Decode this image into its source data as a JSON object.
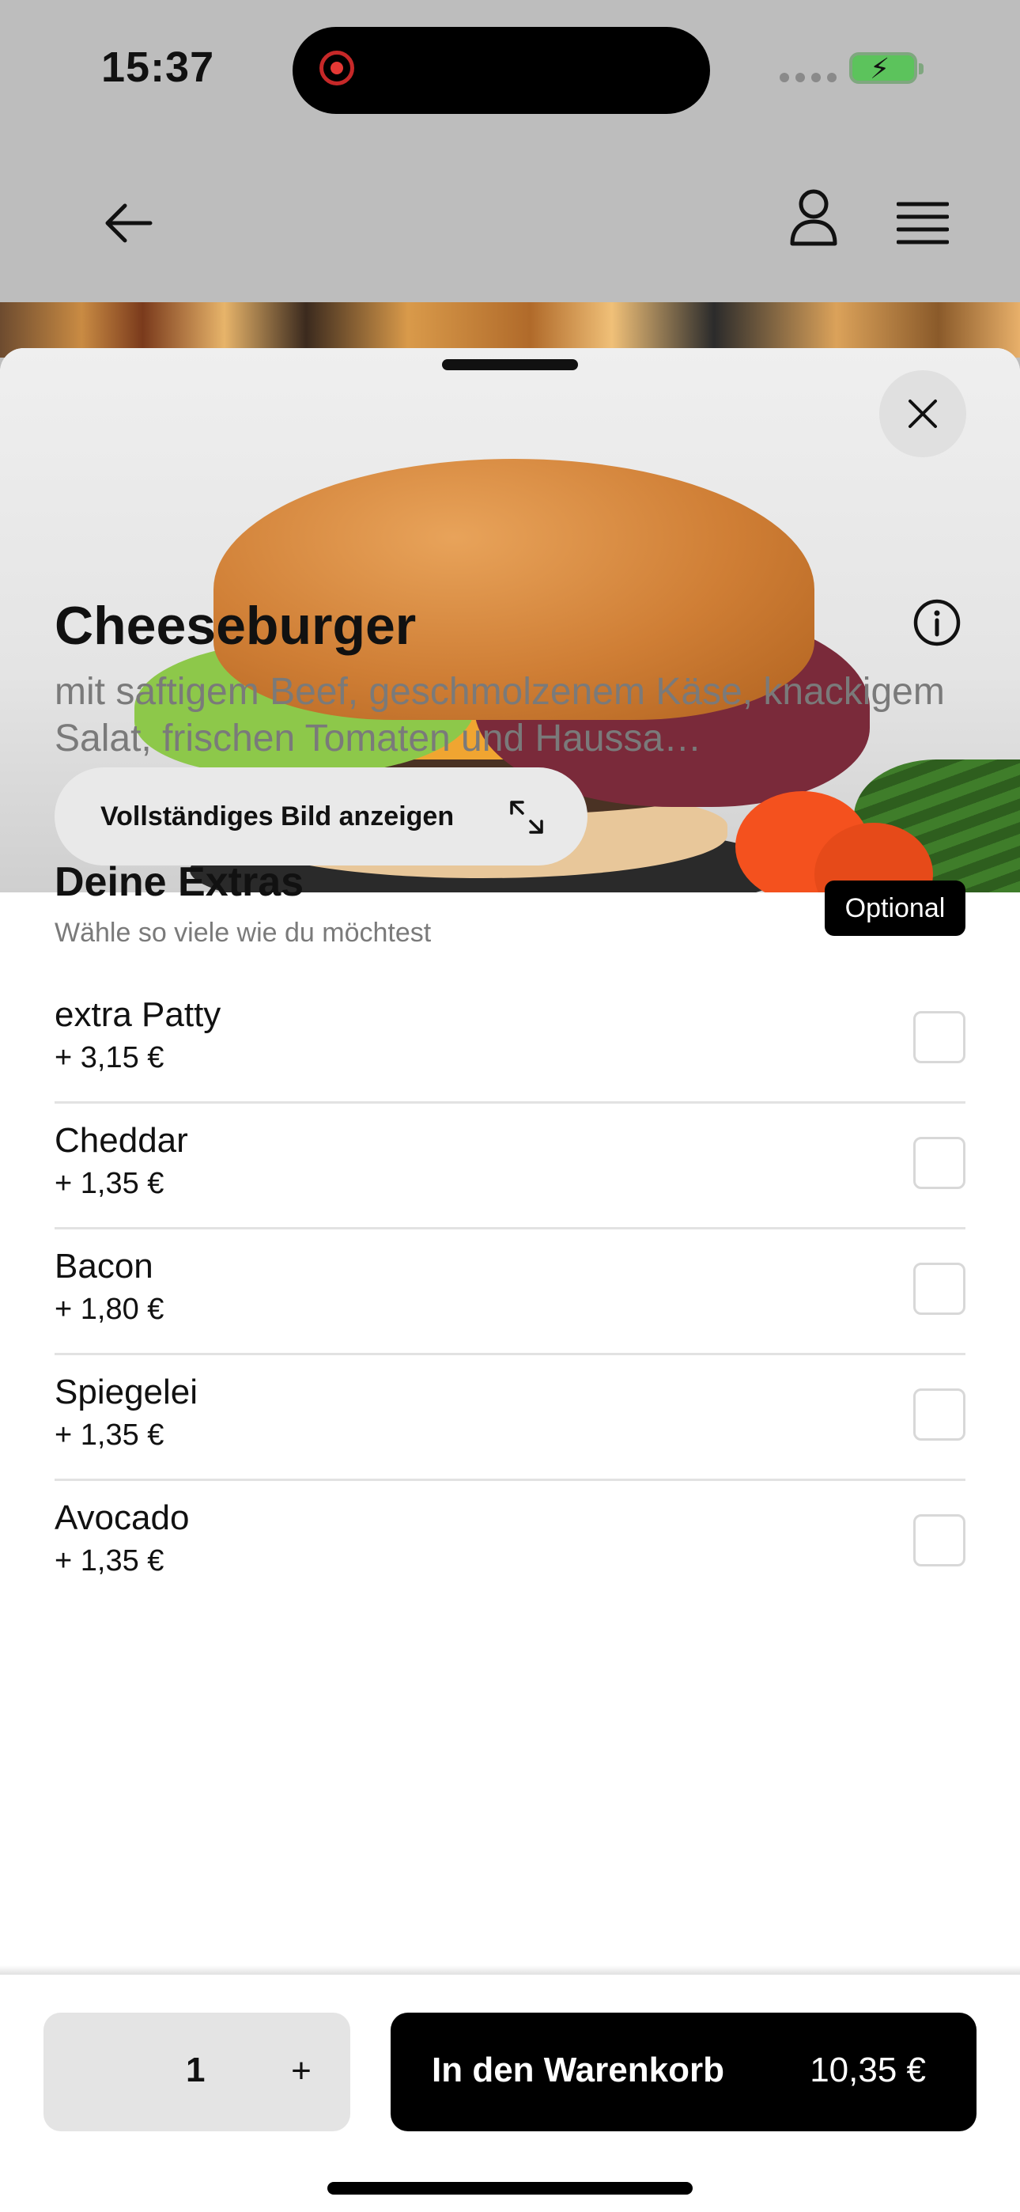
{
  "status_bar": {
    "time": "15:37"
  },
  "product": {
    "title": "Cheeseburger",
    "description": "mit saftigem Beef, geschmolzenem Käse, knackigem Salat, frischen Tomaten und Haussa…",
    "view_full_image_label": "Vollständiges Bild anzeigen"
  },
  "extras": {
    "title": "Deine Extras",
    "subtitle": "Wähle so viele wie du möchtest",
    "badge": "Optional",
    "items": [
      {
        "name": "extra Patty",
        "price": "+ 3,15 €",
        "checked": false
      },
      {
        "name": "Cheddar",
        "price": "+ 1,35 €",
        "checked": false
      },
      {
        "name": "Bacon",
        "price": "+ 1,80 €",
        "checked": false
      },
      {
        "name": "Spiegelei",
        "price": "+ 1,35 €",
        "checked": false
      },
      {
        "name": "Avocado",
        "price": "+ 1,35 €",
        "checked": false
      }
    ]
  },
  "cart": {
    "quantity": "1",
    "plus_label": "+",
    "add_label": "In den Warenkorb",
    "total": "10,35 €"
  },
  "icons": {
    "back": "arrow-left-icon",
    "user": "user-icon",
    "menu": "menu-icon",
    "close": "close-icon",
    "expand": "expand-icon",
    "info": "info-icon"
  },
  "colors": {
    "primary": "#000000",
    "muted_text": "#7a7a7a",
    "surface": "#e4e4e4"
  }
}
